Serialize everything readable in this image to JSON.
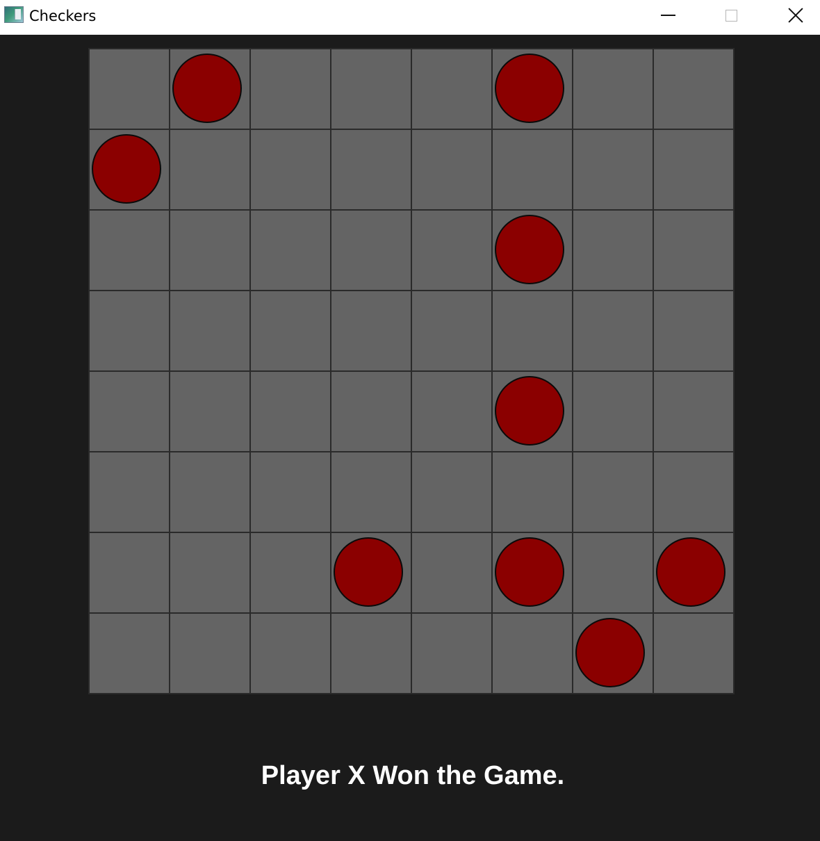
{
  "window": {
    "title": "Checkers",
    "icon": "app-icon",
    "controls": [
      "minimize-icon",
      "maximize-icon",
      "close-icon"
    ]
  },
  "board": {
    "rows": 8,
    "cols": 8,
    "square_color": "#646464",
    "grid_line_color": "#2a2a2a",
    "background_color": "#1b1b1b",
    "pieces": [
      {
        "row": 0,
        "col": 1,
        "color": "#8b0000"
      },
      {
        "row": 0,
        "col": 5,
        "color": "#8b0000"
      },
      {
        "row": 1,
        "col": 0,
        "color": "#8b0000"
      },
      {
        "row": 2,
        "col": 5,
        "color": "#8b0000"
      },
      {
        "row": 4,
        "col": 5,
        "color": "#8b0000"
      },
      {
        "row": 6,
        "col": 3,
        "color": "#8b0000"
      },
      {
        "row": 6,
        "col": 5,
        "color": "#8b0000"
      },
      {
        "row": 6,
        "col": 7,
        "color": "#8b0000"
      },
      {
        "row": 7,
        "col": 6,
        "color": "#8b0000"
      }
    ]
  },
  "status": {
    "message": "Player X Won the Game."
  }
}
